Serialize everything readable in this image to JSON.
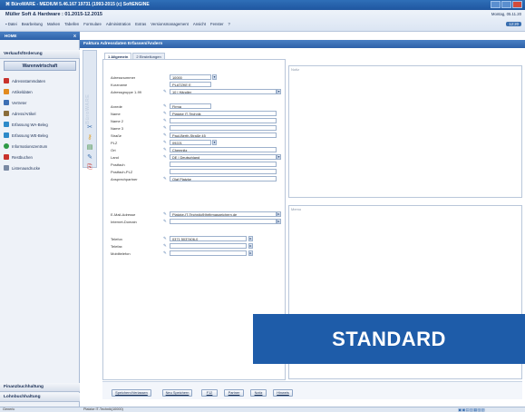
{
  "titlebar": {
    "text": "⌘ BüroWARE - MEDIUM 5.46.167 19731 (1993-2015 (c) SoftENGINE"
  },
  "header": {
    "app_title": "Müller Soft & Hardware : 01.2015-12.2015",
    "date": "Montag, 05.11.20",
    "time": "12:20",
    "menu": [
      "▪ Datei",
      "Bearbeitung",
      "Marken",
      "Tabellen",
      "Formulare",
      "Administration",
      "Extras",
      "Versionsmanagement",
      "Ansicht",
      "Fenster",
      "?"
    ]
  },
  "sidebar": {
    "home_label": "HOME",
    "home_close": "X",
    "top_section": "Verkaufsförderung",
    "group_title": "Warenwirtschaft",
    "items": [
      {
        "label": "Adressstammdaten",
        "icon": "address-book-icon",
        "color": "#c8322d"
      },
      {
        "label": "Artikeldaten",
        "icon": "article-icon",
        "color": "#e28a1e"
      },
      {
        "label": "Vertreter",
        "icon": "agent-icon",
        "color": "#3c6fb4"
      },
      {
        "label": "Adress/Artikel",
        "icon": "address-article-icon",
        "color": "#8a6d3b"
      },
      {
        "label": "Erfassung WA-Beleg",
        "icon": "document-icon",
        "color": "#2d8ac9"
      },
      {
        "label": "Erfassung WE-Beleg",
        "icon": "document-icon",
        "color": "#2d8ac9"
      },
      {
        "label": "Informationszentrum",
        "icon": "globe-icon",
        "color": "#2e9a46"
      },
      {
        "label": "Restbuchen",
        "icon": "booking-icon",
        "color": "#c8322d"
      },
      {
        "label": "Listenausdrucke",
        "icon": "print-list-icon",
        "color": "#7a8aa3"
      }
    ],
    "bottom_sections": [
      "Finanzbuchhaltung",
      "Lohnbuchhaltung"
    ],
    "vertical_strip_text": "BüroWARE"
  },
  "form": {
    "title": "Faktura Adressdaten Erfassen/Ändern",
    "tabs": [
      "1 Allgemein",
      "2 Einstellungen"
    ],
    "fields": [
      {
        "label": "Adressnummer",
        "value": "10000"
      },
      {
        "label": "Kurzname",
        "value": "PLATZKE E"
      },
      {
        "label": "Adressgruppe 1-99",
        "value": "10 | Händler"
      },
      {
        "label": "Anrede",
        "value": "Firma"
      },
      {
        "label": "Name",
        "value": "Platzke IT-Technik"
      },
      {
        "label": "Name 2",
        "value": ""
      },
      {
        "label": "Name 3",
        "value": ""
      },
      {
        "label": "Straße",
        "value": "Paul-Berth-Straße 45"
      },
      {
        "label": "PLZ",
        "value": "09221"
      },
      {
        "label": "Ort",
        "value": "Chemnitz"
      },
      {
        "label": "Land",
        "value": "DE  | Deutschland"
      },
      {
        "label": "Postfach",
        "value": ""
      },
      {
        "label": "Postfach-PLZ",
        "value": ""
      },
      {
        "label": "Ansprechpartner",
        "value": "Olaf Platzke"
      },
      {
        "label": "E-Mail-Adresse",
        "value": "Platzke-IT-Technik@Ihrfirmaspeichern.de"
      },
      {
        "label": "Internet-Domain",
        "value": ""
      },
      {
        "label": "Telefon",
        "value": "0371 5037406-0"
      },
      {
        "label": "Telefax",
        "value": ""
      },
      {
        "label": "Mobiltelefon",
        "value": ""
      }
    ],
    "notes_label": "Notiz",
    "memo_label": "Memo"
  },
  "buttons": [
    "Speichern/Verlassen",
    "Neu Speichern",
    "F12",
    "Partner",
    "Notiz",
    "Hinweis"
  ],
  "statusbar": {
    "left": "Generic",
    "middle": "Platzke IT-Technik(10000)"
  },
  "overlay": {
    "text": "STANDARD",
    "color": "#1e5ca9"
  }
}
